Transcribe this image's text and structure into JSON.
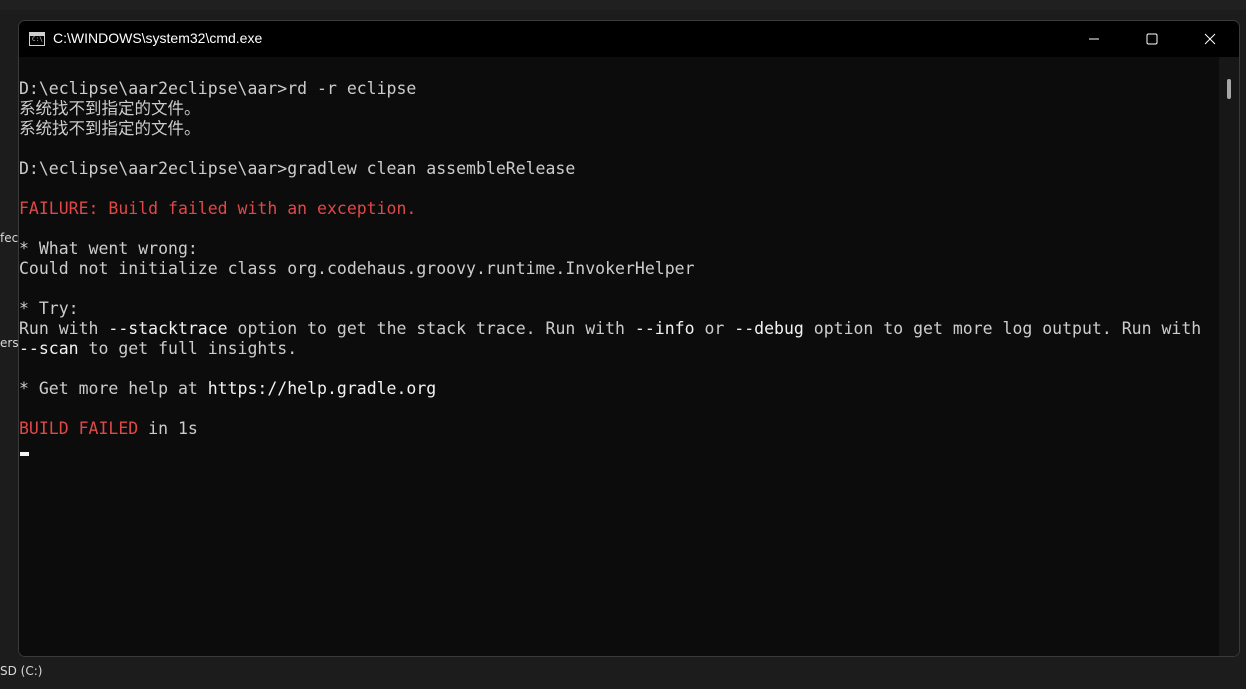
{
  "window": {
    "title": "C:\\WINDOWS\\system32\\cmd.exe",
    "icon": "cmd-icon",
    "controls": {
      "minimize": "minimize-icon",
      "maximize": "maximize-icon",
      "close": "close-icon"
    }
  },
  "background": {
    "frag1": "fec",
    "frag2": "ers",
    "frag3": "SD (C:)"
  },
  "console": {
    "lines": {
      "l1": "D:\\eclipse\\aar2eclipse\\aar>rd -r eclipse",
      "l2": "系统找不到指定的文件。",
      "l3": "系统找不到指定的文件。",
      "l4": "D:\\eclipse\\aar2eclipse\\aar>gradlew clean assembleRelease",
      "l5": "FAILURE: Build failed with an exception.",
      "l6": "* What went wrong:",
      "l7": "Could not initialize class org.codehaus.groovy.runtime.InvokerHelper",
      "l8": "* Try:",
      "l9a": "Run with ",
      "l9b": "--stacktrace",
      "l9c": " option to get the stack trace. Run with ",
      "l9d": "--info",
      "l9e": " or ",
      "l9f": "--debug",
      "l9g": " option to get more log output. Run with",
      "l10a": "--scan",
      "l10b": " to get full insights.",
      "l11a": "* Get more help at ",
      "l11b": "https://help.gradle.org",
      "l12a": "BUILD FAILED",
      "l12b": " in 1s"
    }
  },
  "colors": {
    "text": "#cccccc",
    "error": "#e04848",
    "bright": "#f2f2f2",
    "background": "#0c0c0c"
  }
}
